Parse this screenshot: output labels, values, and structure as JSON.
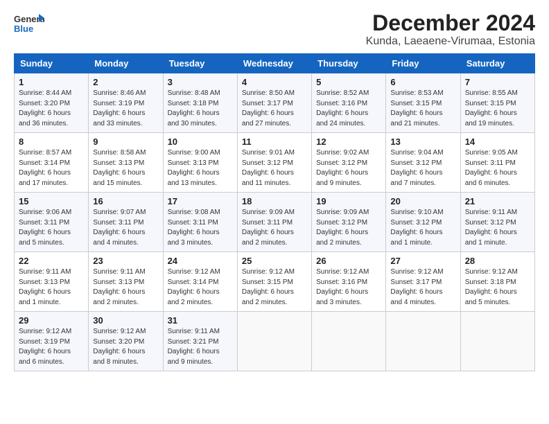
{
  "header": {
    "logo_general": "General",
    "logo_blue": "Blue",
    "month_year": "December 2024",
    "location": "Kunda, Laeaene-Virumaa, Estonia"
  },
  "weekdays": [
    "Sunday",
    "Monday",
    "Tuesday",
    "Wednesday",
    "Thursday",
    "Friday",
    "Saturday"
  ],
  "weeks": [
    [
      {
        "day": "1",
        "info": "Sunrise: 8:44 AM\nSunset: 3:20 PM\nDaylight: 6 hours\nand 36 minutes."
      },
      {
        "day": "2",
        "info": "Sunrise: 8:46 AM\nSunset: 3:19 PM\nDaylight: 6 hours\nand 33 minutes."
      },
      {
        "day": "3",
        "info": "Sunrise: 8:48 AM\nSunset: 3:18 PM\nDaylight: 6 hours\nand 30 minutes."
      },
      {
        "day": "4",
        "info": "Sunrise: 8:50 AM\nSunset: 3:17 PM\nDaylight: 6 hours\nand 27 minutes."
      },
      {
        "day": "5",
        "info": "Sunrise: 8:52 AM\nSunset: 3:16 PM\nDaylight: 6 hours\nand 24 minutes."
      },
      {
        "day": "6",
        "info": "Sunrise: 8:53 AM\nSunset: 3:15 PM\nDaylight: 6 hours\nand 21 minutes."
      },
      {
        "day": "7",
        "info": "Sunrise: 8:55 AM\nSunset: 3:15 PM\nDaylight: 6 hours\nand 19 minutes."
      }
    ],
    [
      {
        "day": "8",
        "info": "Sunrise: 8:57 AM\nSunset: 3:14 PM\nDaylight: 6 hours\nand 17 minutes."
      },
      {
        "day": "9",
        "info": "Sunrise: 8:58 AM\nSunset: 3:13 PM\nDaylight: 6 hours\nand 15 minutes."
      },
      {
        "day": "10",
        "info": "Sunrise: 9:00 AM\nSunset: 3:13 PM\nDaylight: 6 hours\nand 13 minutes."
      },
      {
        "day": "11",
        "info": "Sunrise: 9:01 AM\nSunset: 3:12 PM\nDaylight: 6 hours\nand 11 minutes."
      },
      {
        "day": "12",
        "info": "Sunrise: 9:02 AM\nSunset: 3:12 PM\nDaylight: 6 hours\nand 9 minutes."
      },
      {
        "day": "13",
        "info": "Sunrise: 9:04 AM\nSunset: 3:12 PM\nDaylight: 6 hours\nand 7 minutes."
      },
      {
        "day": "14",
        "info": "Sunrise: 9:05 AM\nSunset: 3:11 PM\nDaylight: 6 hours\nand 6 minutes."
      }
    ],
    [
      {
        "day": "15",
        "info": "Sunrise: 9:06 AM\nSunset: 3:11 PM\nDaylight: 6 hours\nand 5 minutes."
      },
      {
        "day": "16",
        "info": "Sunrise: 9:07 AM\nSunset: 3:11 PM\nDaylight: 6 hours\nand 4 minutes."
      },
      {
        "day": "17",
        "info": "Sunrise: 9:08 AM\nSunset: 3:11 PM\nDaylight: 6 hours\nand 3 minutes."
      },
      {
        "day": "18",
        "info": "Sunrise: 9:09 AM\nSunset: 3:11 PM\nDaylight: 6 hours\nand 2 minutes."
      },
      {
        "day": "19",
        "info": "Sunrise: 9:09 AM\nSunset: 3:12 PM\nDaylight: 6 hours\nand 2 minutes."
      },
      {
        "day": "20",
        "info": "Sunrise: 9:10 AM\nSunset: 3:12 PM\nDaylight: 6 hours\nand 1 minute."
      },
      {
        "day": "21",
        "info": "Sunrise: 9:11 AM\nSunset: 3:12 PM\nDaylight: 6 hours\nand 1 minute."
      }
    ],
    [
      {
        "day": "22",
        "info": "Sunrise: 9:11 AM\nSunset: 3:13 PM\nDaylight: 6 hours\nand 1 minute."
      },
      {
        "day": "23",
        "info": "Sunrise: 9:11 AM\nSunset: 3:13 PM\nDaylight: 6 hours\nand 2 minutes."
      },
      {
        "day": "24",
        "info": "Sunrise: 9:12 AM\nSunset: 3:14 PM\nDaylight: 6 hours\nand 2 minutes."
      },
      {
        "day": "25",
        "info": "Sunrise: 9:12 AM\nSunset: 3:15 PM\nDaylight: 6 hours\nand 2 minutes."
      },
      {
        "day": "26",
        "info": "Sunrise: 9:12 AM\nSunset: 3:16 PM\nDaylight: 6 hours\nand 3 minutes."
      },
      {
        "day": "27",
        "info": "Sunrise: 9:12 AM\nSunset: 3:17 PM\nDaylight: 6 hours\nand 4 minutes."
      },
      {
        "day": "28",
        "info": "Sunrise: 9:12 AM\nSunset: 3:18 PM\nDaylight: 6 hours\nand 5 minutes."
      }
    ],
    [
      {
        "day": "29",
        "info": "Sunrise: 9:12 AM\nSunset: 3:19 PM\nDaylight: 6 hours\nand 6 minutes."
      },
      {
        "day": "30",
        "info": "Sunrise: 9:12 AM\nSunset: 3:20 PM\nDaylight: 6 hours\nand 8 minutes."
      },
      {
        "day": "31",
        "info": "Sunrise: 9:11 AM\nSunset: 3:21 PM\nDaylight: 6 hours\nand 9 minutes."
      },
      {
        "day": "",
        "info": ""
      },
      {
        "day": "",
        "info": ""
      },
      {
        "day": "",
        "info": ""
      },
      {
        "day": "",
        "info": ""
      }
    ]
  ]
}
